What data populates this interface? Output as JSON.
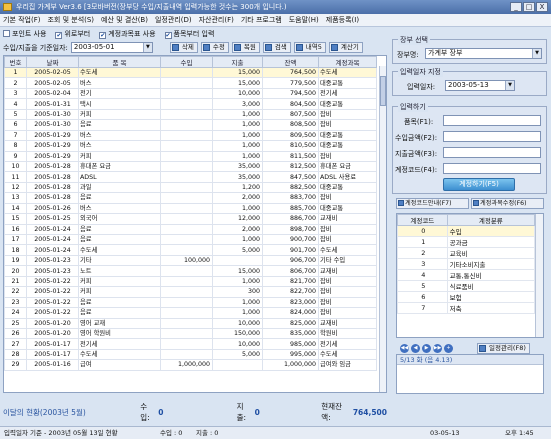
{
  "window": {
    "title": "우리집 가계부 Ver3.6 [3모바버전(장부당 수입/지출내역 입력가능한 것수는 300개 입니다.)",
    "buttons": [
      "_",
      "□",
      "X"
    ]
  },
  "menu": [
    "기본 작업(F)",
    "조회 및 분석(S)",
    "예산 및 결산(B)",
    "일정관리(D)",
    "자산관리(F)",
    "기타 프로그램",
    "도움말(H)",
    "제품등록(I)"
  ],
  "options": [
    {
      "label": "포인트 사용",
      "checked": false
    },
    {
      "label": "위로부터",
      "checked": true
    },
    {
      "label": "계정과목표 사용",
      "checked": true
    },
    {
      "label": "품목부터 입력",
      "checked": true
    }
  ],
  "query": {
    "label": "수입/지출을 기준일자:",
    "date": "2003-05-01",
    "buttons": [
      "삭제",
      "수정",
      "복원",
      "검색",
      "내역5",
      "계산기"
    ]
  },
  "grid": {
    "headers": [
      "번호",
      "날짜",
      "품 목",
      "수입",
      "지출",
      "잔액",
      "계정과목"
    ],
    "rows": [
      [
        "1",
        "2005-02-05",
        "수도세",
        "",
        "15,000",
        "764,500",
        "수도세"
      ],
      [
        "2",
        "2005-02-05",
        "버스",
        "",
        "15,000",
        "779,500",
        "대중교통"
      ],
      [
        "3",
        "2005-02-04",
        "전기",
        "",
        "10,000",
        "794,500",
        "전기세"
      ],
      [
        "4",
        "2005-01-31",
        "택시",
        "",
        "3,000",
        "804,500",
        "대중교통"
      ],
      [
        "5",
        "2005-01-30",
        "커피",
        "",
        "1,000",
        "807,500",
        "잡비"
      ],
      [
        "6",
        "2005-01-30",
        "음료",
        "",
        "1,000",
        "808,500",
        "잡비"
      ],
      [
        "7",
        "2005-01-29",
        "버스",
        "",
        "1,000",
        "809,500",
        "대중교통"
      ],
      [
        "8",
        "2005-01-29",
        "버스",
        "",
        "1,000",
        "810,500",
        "대중교통"
      ],
      [
        "9",
        "2005-01-29",
        "커피",
        "",
        "1,000",
        "811,500",
        "잡비"
      ],
      [
        "10",
        "2005-01-28",
        "휴대폰 요금",
        "",
        "35,000",
        "812,500",
        "휴대폰 요금"
      ],
      [
        "11",
        "2005-01-28",
        "ADSL",
        "",
        "35,000",
        "847,500",
        "ADSL 사용료"
      ],
      [
        "12",
        "2005-01-28",
        "과일",
        "",
        "1,200",
        "882,500",
        "대중교통"
      ],
      [
        "13",
        "2005-01-28",
        "음료",
        "",
        "2,000",
        "883,700",
        "잡비"
      ],
      [
        "14",
        "2005-01-26",
        "버스",
        "",
        "1,000",
        "885,700",
        "대중교통"
      ],
      [
        "15",
        "2005-01-25",
        "외국어",
        "",
        "12,000",
        "886,700",
        "교재비"
      ],
      [
        "16",
        "2005-01-24",
        "음료",
        "",
        "2,000",
        "898,700",
        "잡비"
      ],
      [
        "17",
        "2005-01-24",
        "음료",
        "",
        "1,000",
        "900,700",
        "잡비"
      ],
      [
        "18",
        "2005-01-24",
        "수도세",
        "",
        "5,000",
        "901,700",
        "수도세"
      ],
      [
        "19",
        "2005-01-23",
        "기타",
        "100,000",
        "",
        "906,700",
        "기타 수입"
      ],
      [
        "20",
        "2005-01-23",
        "노트",
        "",
        "15,000",
        "806,700",
        "교재비"
      ],
      [
        "21",
        "2005-01-22",
        "커피",
        "",
        "1,000",
        "821,700",
        "잡비"
      ],
      [
        "22",
        "2005-01-22",
        "커피",
        "",
        "300",
        "822,700",
        "잡비"
      ],
      [
        "23",
        "2005-01-22",
        "음료",
        "",
        "1,000",
        "823,000",
        "잡비"
      ],
      [
        "24",
        "2005-01-22",
        "음료",
        "",
        "1,000",
        "824,000",
        "잡비"
      ],
      [
        "25",
        "2005-01-20",
        "영어 교재",
        "",
        "10,000",
        "825,000",
        "교재비"
      ],
      [
        "26",
        "2005-01-20",
        "영어 학원비",
        "",
        "150,000",
        "835,000",
        "학원비"
      ],
      [
        "27",
        "2005-01-17",
        "전기세",
        "",
        "10,000",
        "985,000",
        "전기세"
      ],
      [
        "28",
        "2005-01-17",
        "수도세",
        "",
        "5,000",
        "995,000",
        "수도세"
      ],
      [
        "29",
        "2005-01-16",
        "급여",
        "1,000,000",
        "",
        "1,000,000",
        "급여와 임금"
      ]
    ],
    "selected_row": 0
  },
  "summary": {
    "label": "이달의 현황(2003년 5월)",
    "income_label": "수입:",
    "income": "0",
    "expense_label": "지출:",
    "expense": "0",
    "balance_label": "현재잔액:",
    "balance": "764,500"
  },
  "ledger": {
    "title": "장부 선택",
    "label": "장부명:",
    "value": "가계부 장부"
  },
  "date_input": {
    "title": "입력일자 지정",
    "label": "입력일자:",
    "value": "2003-05-13"
  },
  "entry": {
    "title": "입력하기",
    "fields": [
      "품목(F1):",
      "수입금액(F2):",
      "지출금액(F3):",
      "계정코드(F4):"
    ],
    "submit": "계정하기(F5)"
  },
  "tabs": [
    "계정코드안내(F7)",
    "계정과목수정(F6)"
  ],
  "accounts": {
    "headers": [
      "계정코드",
      "계정분류"
    ],
    "rows": [
      [
        "0",
        "수입"
      ],
      [
        "1",
        "공과금"
      ],
      [
        "2",
        "교육비"
      ],
      [
        "3",
        "기타소비지출"
      ],
      [
        "4",
        "교통,통신비"
      ],
      [
        "5",
        "식료품비"
      ],
      [
        "6",
        "보험"
      ],
      [
        "7",
        "저축"
      ]
    ],
    "selected_row": 0
  },
  "schedule": {
    "button": "일정관리(F8)",
    "memo": "5/13 화 (음 4.13)"
  },
  "statusbar": {
    "left": "입력일자 기준 - 2003년 05월 13일 현황",
    "income": "수입 : 0",
    "expense": "지출 : 0",
    "date": "03-05-13",
    "time": "오후 1:45"
  }
}
